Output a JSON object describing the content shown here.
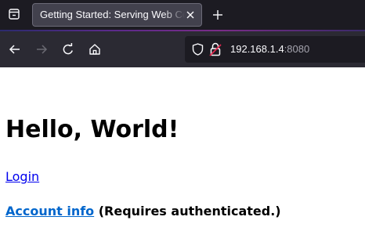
{
  "browser": {
    "tab": {
      "title": "Getting Started: Serving Web Content"
    },
    "url": {
      "host": "192.168.1.4",
      "port": ":8080"
    },
    "icons": {
      "tab_list": "tab-list-icon",
      "tab_close": "close-icon",
      "new_tab": "plus-icon",
      "back": "arrow-left-icon",
      "forward": "arrow-right-icon",
      "reload": "reload-icon",
      "home": "home-icon",
      "tracking_protection": "shield-icon",
      "insecure": "lock-warning-icon"
    },
    "colors": {
      "tabstrip": "#1c1b22",
      "toolbar": "#2b2a33",
      "insecure_accent": "#e22850",
      "link": "#0000ee"
    }
  },
  "page": {
    "heading": "Hello, World!",
    "login_link": "Login",
    "account_link": "Account info",
    "account_note": " (Requires authenticated.)"
  }
}
